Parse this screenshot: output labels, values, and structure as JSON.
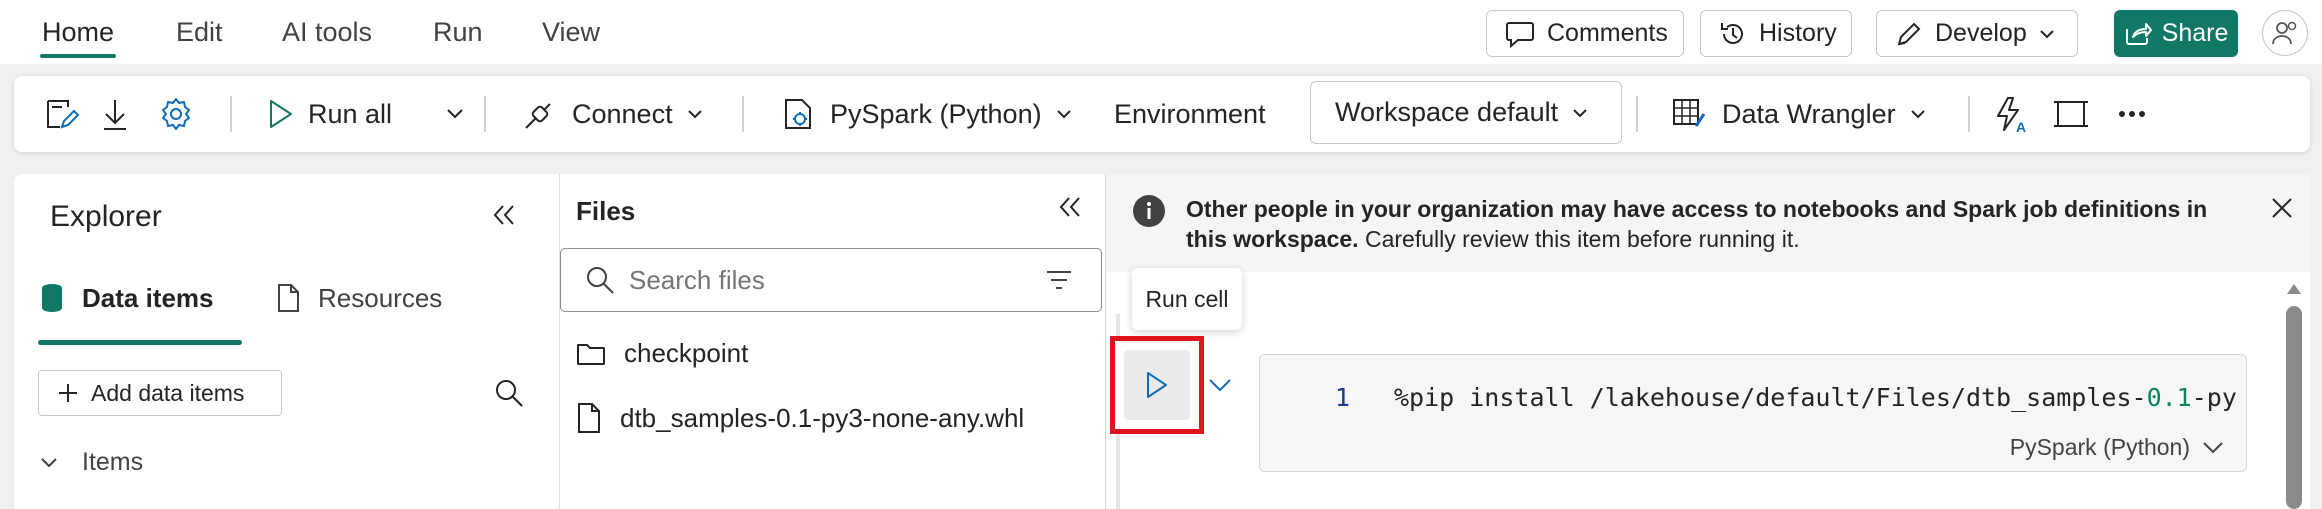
{
  "menu": {
    "tabs": [
      "Home",
      "Edit",
      "AI tools",
      "Run",
      "View"
    ],
    "active_tab": "Home"
  },
  "top_actions": {
    "comments": "Comments",
    "history": "History",
    "develop": "Develop",
    "share": "Share"
  },
  "ribbon": {
    "run_all": "Run all",
    "connect": "Connect",
    "language": "PySpark (Python)",
    "environment_label": "Environment",
    "environment_value": "Workspace default",
    "data_wrangler": "Data Wrangler"
  },
  "explorer": {
    "title": "Explorer",
    "tabs": [
      "Data items",
      "Resources"
    ],
    "active_tab": "Data items",
    "add_button": "Add data items",
    "section": "Items"
  },
  "files": {
    "title": "Files",
    "search_placeholder": "Search files",
    "items": [
      {
        "name": "checkpoint",
        "type": "folder"
      },
      {
        "name": "dtb_samples-0.1-py3-none-any.whl",
        "type": "file"
      }
    ]
  },
  "banner": {
    "bold": "Other people in your organization may have access to notebooks and Spark job definitions in this workspace.",
    "normal": "Carefully review this item before running it."
  },
  "cell": {
    "tooltip": "Run cell",
    "line_number": "1",
    "code_before": "%pip install /lakehouse/default/Files/dtb_samples-",
    "code_number": "0.1",
    "code_after": "-py",
    "language": "PySpark (Python)"
  },
  "colors": {
    "accent": "#117865",
    "highlight": "#e0141b",
    "link_blue": "#0f6cbd"
  }
}
